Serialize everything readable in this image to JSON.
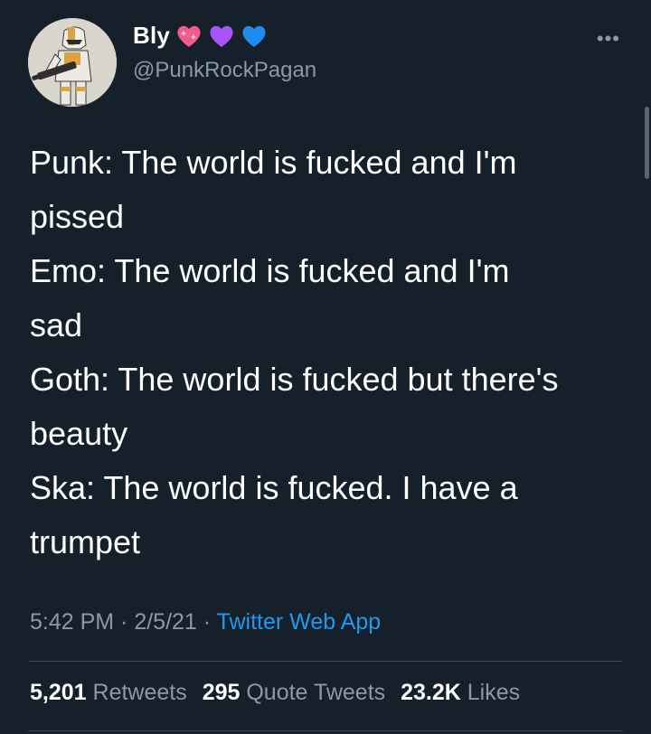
{
  "author": {
    "display_name": "Bly",
    "emojis": [
      "sparkling-heart",
      "purple-heart",
      "blue-heart"
    ],
    "handle": "@PunkRockPagan"
  },
  "more_label": "•••",
  "tweet": {
    "lines": [
      "Punk: The world is fucked and I'm",
      "pissed",
      "Emo: The world is fucked and I'm",
      "sad",
      "Goth: The world is fucked but there's",
      "beauty",
      "Ska: The world is fucked. I have a",
      "trumpet"
    ]
  },
  "meta": {
    "time": "5:42 PM",
    "sep1": " · ",
    "date": "2/5/21",
    "sep2": " · ",
    "app": "Twitter Web App"
  },
  "stats": {
    "retweets_count": "5,201",
    "retweets_label": "Retweets",
    "quotes_count": "295",
    "quotes_label": "Quote Tweets",
    "likes_count": "23.2K",
    "likes_label": "Likes"
  },
  "colors": {
    "background": "#15202b",
    "secondary_text": "#8b98a5",
    "link": "#1d9bf0",
    "heart_pink": "#f45b8d",
    "heart_purple": "#a855f7",
    "heart_blue": "#1d8bf0"
  }
}
